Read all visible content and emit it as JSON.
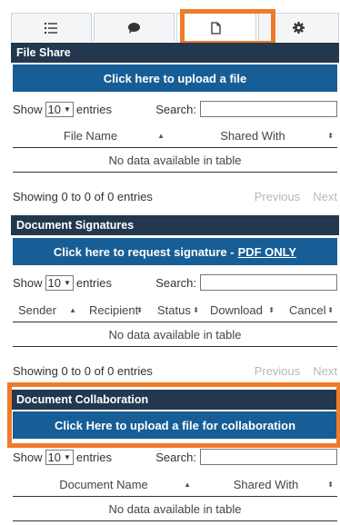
{
  "colors": {
    "header_bg": "#23384f",
    "button_bg": "#175e96",
    "highlight": "#ef7b28",
    "disabled_text": "#b5b9be"
  },
  "tabs": [
    {
      "icon": "list-icon",
      "active": false
    },
    {
      "icon": "comment-icon",
      "active": false
    },
    {
      "icon": "file-icon",
      "active": true
    },
    {
      "icon": "gear-icon",
      "active": false
    }
  ],
  "file_share": {
    "title": "File Share",
    "upload_label": "Click here to upload a file",
    "show_label": "Show",
    "entries_value": "10",
    "entries_label": "entries",
    "search_label": "Search:",
    "columns": [
      "File Name",
      "Shared With"
    ],
    "empty_text": "No data available in table",
    "info_text": "Showing 0 to 0 of 0 entries",
    "previous_label": "Previous",
    "next_label": "Next"
  },
  "signatures": {
    "title": "Document Signatures",
    "request_label": "Click here to request signature -",
    "pdf_only_label": "PDF ONLY",
    "show_label": "Show",
    "entries_value": "10",
    "entries_label": "entries",
    "search_label": "Search:",
    "columns": [
      "Sender",
      "Recipient",
      "Status",
      "Download",
      "Cancel"
    ],
    "empty_text": "No data available in table",
    "info_text": "Showing 0 to 0 of 0 entries",
    "previous_label": "Previous",
    "next_label": "Next"
  },
  "collaboration": {
    "title": "Document Collaboration",
    "upload_label": "Click Here to upload a file for collaboration",
    "show_label": "Show",
    "entries_value": "10",
    "entries_label": "entries",
    "search_label": "Search:",
    "columns": [
      "Document Name",
      "Shared With"
    ],
    "empty_text": "No data available in table"
  }
}
